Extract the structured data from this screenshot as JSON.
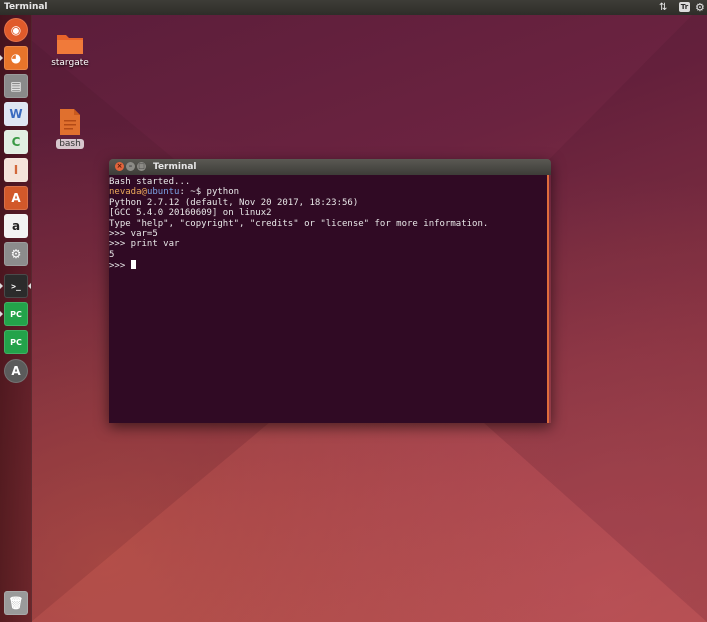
{
  "top_panel": {
    "title": "Terminal",
    "keyboard_indicator": "Tr",
    "network_glyph": "⇅",
    "settings_glyph": "⚙"
  },
  "launcher": {
    "items": [
      {
        "name": "ubuntu-dash-icon",
        "glyph": "◉",
        "color": "#e05a2a"
      },
      {
        "name": "firefox-icon",
        "glyph": "◕",
        "color": "#e8742a"
      },
      {
        "name": "files-icon",
        "glyph": "▤",
        "color": "#8a8a8a"
      },
      {
        "name": "writer-icon",
        "glyph": "W",
        "color": "#3b6bc0"
      },
      {
        "name": "calc-icon",
        "glyph": "C",
        "color": "#3a9a45"
      },
      {
        "name": "impress-icon",
        "glyph": "I",
        "color": "#d2683a"
      },
      {
        "name": "software-center-icon",
        "glyph": "A",
        "color": "#d2582a"
      },
      {
        "name": "amazon-icon",
        "glyph": "a",
        "color": "#f2f2f2"
      },
      {
        "name": "system-settings-icon",
        "glyph": "⚙",
        "color": "#8c8c8c"
      },
      {
        "name": "terminal-icon",
        "glyph": ">_",
        "color": "#2b2b2b"
      },
      {
        "name": "pycharm-icon",
        "glyph": "PC",
        "color": "#23a34a"
      },
      {
        "name": "pycharm-icon-2",
        "glyph": "PC",
        "color": "#23a34a"
      },
      {
        "name": "software-updater-icon",
        "glyph": "A",
        "color": "#5b5b5b"
      }
    ],
    "trash_glyph": "🗑"
  },
  "desktop": {
    "icons": [
      {
        "label": "stargate"
      },
      {
        "label": "bash"
      }
    ]
  },
  "terminal": {
    "title": "Terminal",
    "buttons": {
      "close": "×",
      "minimize": "–",
      "maximize": "□"
    },
    "lines": [
      "Bash started...",
      "",
      "Python 2.7.12 (default, Nov 20 2017, 18:23:56)",
      "[GCC 5.4.0 20160609] on linux2",
      "Type \"help\", \"copyright\", \"credits\" or \"license\" for more information.",
      ">>> var=5",
      ">>> print var",
      "5"
    ],
    "prompt": {
      "user": "nevada",
      "at": "@",
      "host": "ubuntu",
      "path": ": ~$ ",
      "command": "python"
    },
    "current_prompt": ">>> "
  },
  "colors": {
    "terminal_bg": "#300a24",
    "accent": "#e06c3c"
  }
}
